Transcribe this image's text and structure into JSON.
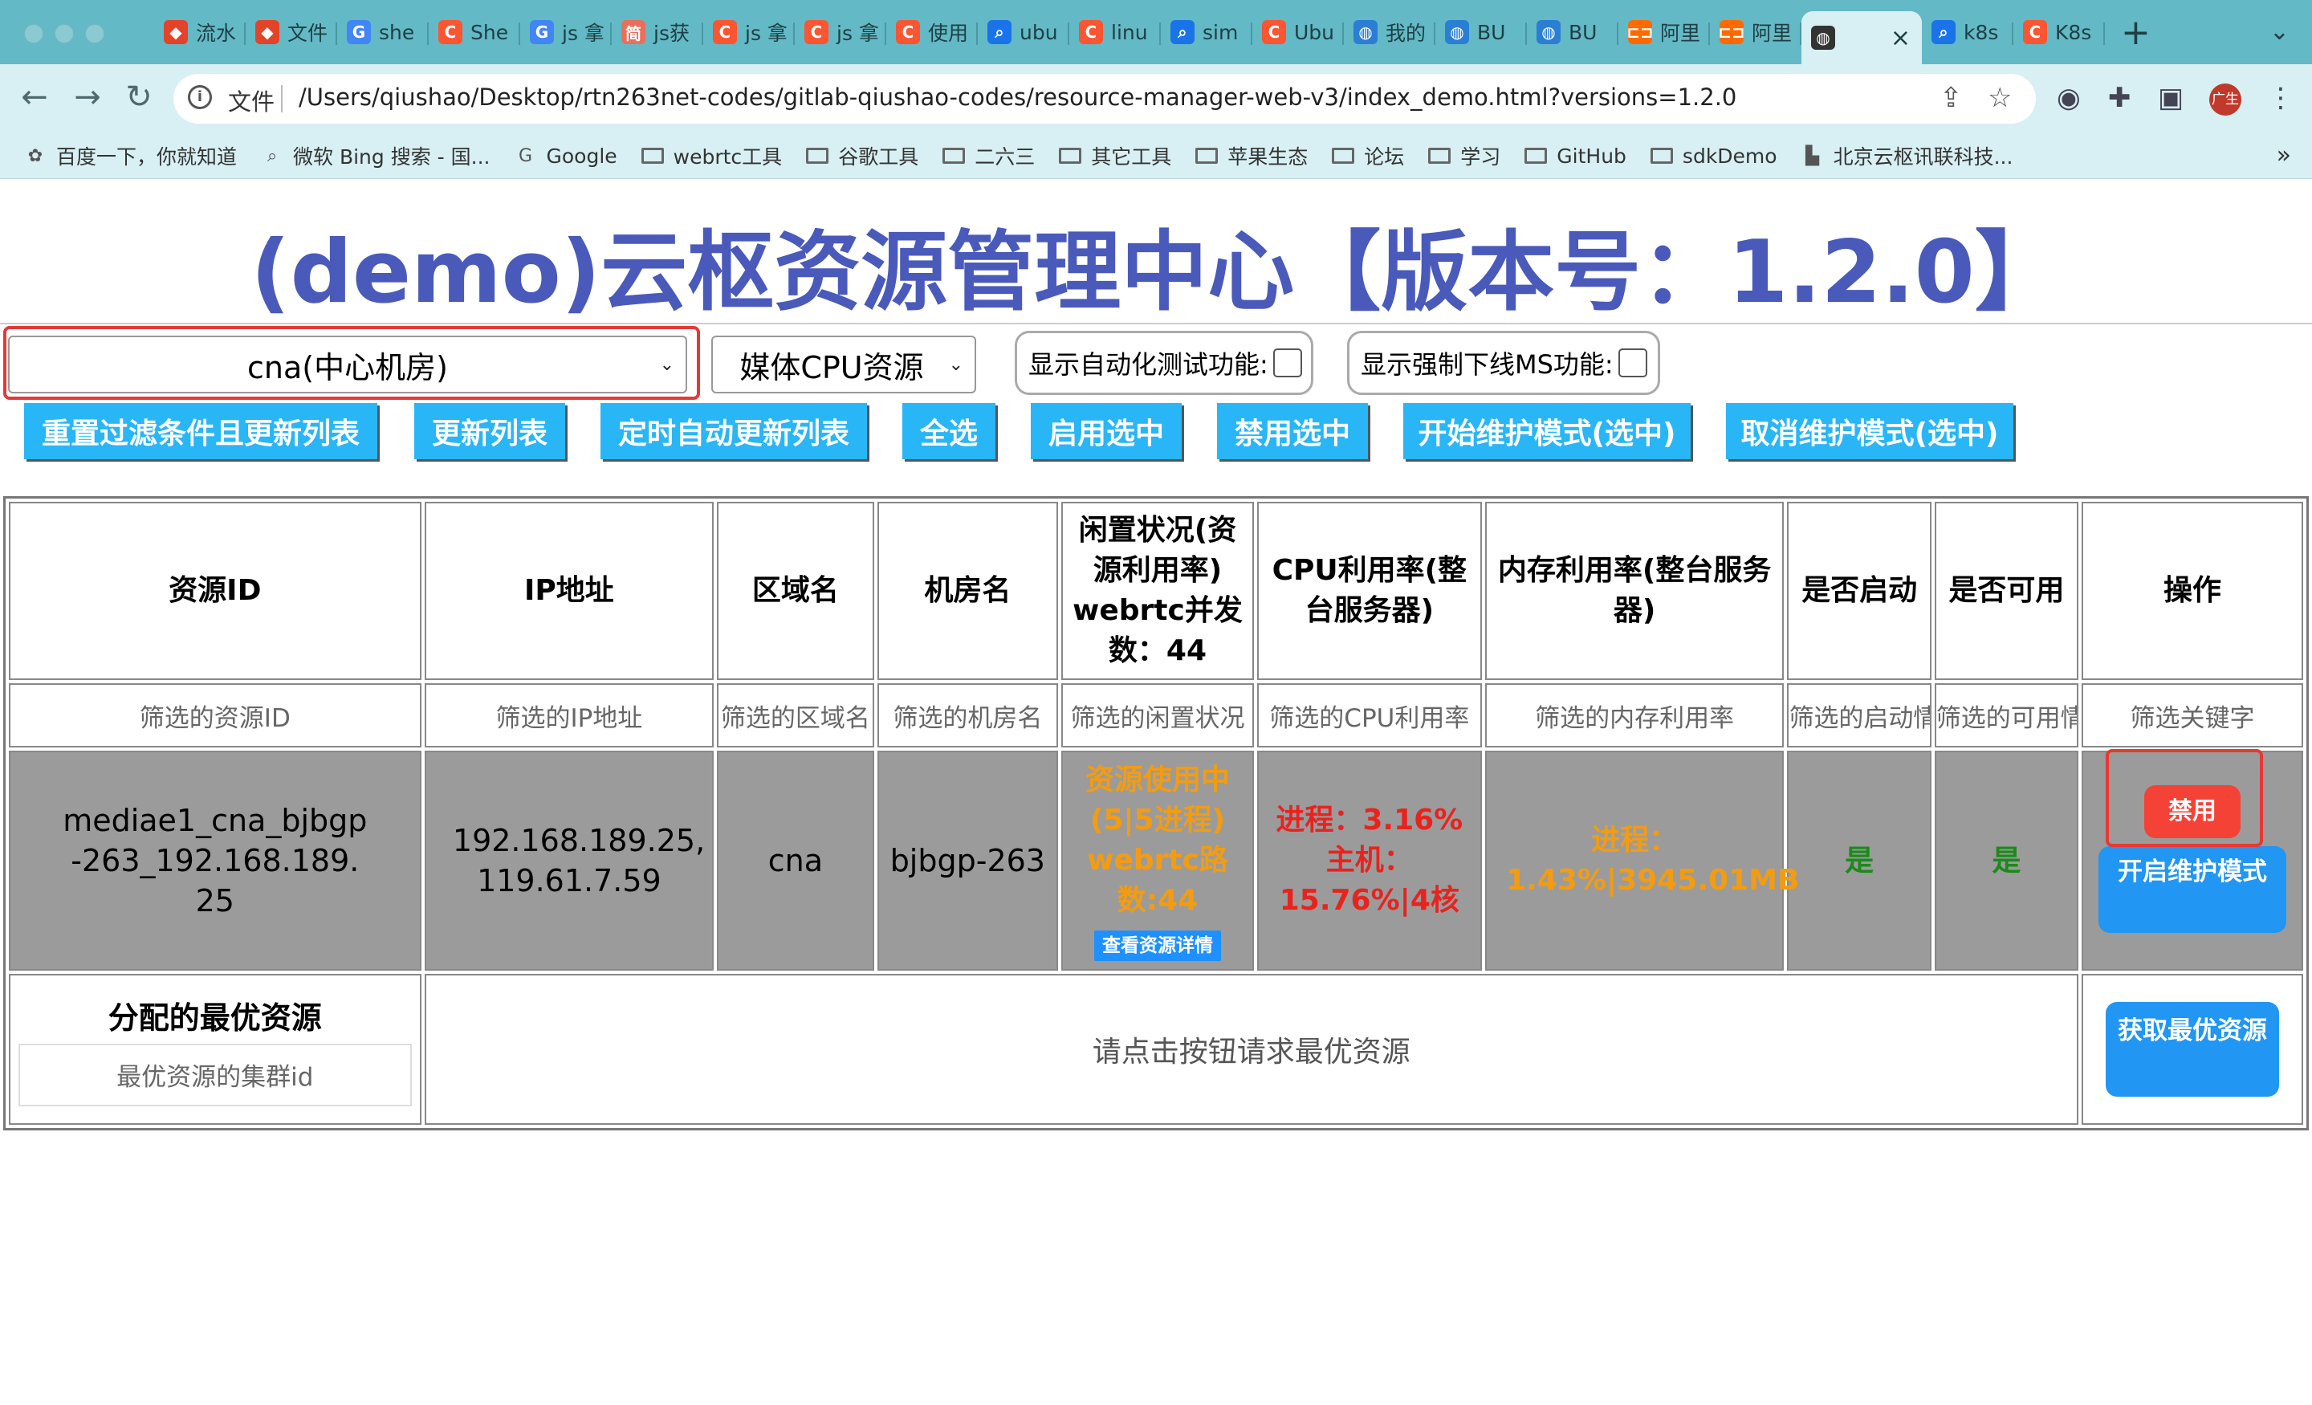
{
  "browser": {
    "tabs": [
      {
        "label": "流水",
        "icon": "gitlab-icon",
        "color": "#e24329"
      },
      {
        "label": "文件",
        "icon": "gitlab-icon",
        "color": "#e24329"
      },
      {
        "label": "she",
        "icon": "google-icon",
        "color": "#4285f4"
      },
      {
        "label": "She",
        "icon": "csdn-icon",
        "color": "#fc5531"
      },
      {
        "label": "js 拿",
        "icon": "google-icon",
        "color": "#4285f4"
      },
      {
        "label": "js获",
        "icon": "jianshu-icon",
        "color": "#ea6f5a"
      },
      {
        "label": "js 拿",
        "icon": "csdn-icon",
        "color": "#fc5531"
      },
      {
        "label": "js 拿",
        "icon": "csdn-icon",
        "color": "#fc5531"
      },
      {
        "label": "使用",
        "icon": "csdn-icon",
        "color": "#fc5531"
      },
      {
        "label": "ubu",
        "icon": "search-icon",
        "color": "#1a73e8"
      },
      {
        "label": "linu",
        "icon": "csdn-icon",
        "color": "#fc5531"
      },
      {
        "label": "sim",
        "icon": "search-icon",
        "color": "#1a73e8"
      },
      {
        "label": "Ubu",
        "icon": "csdn-icon",
        "color": "#fc5531"
      },
      {
        "label": "我的",
        "icon": "globe-icon",
        "color": "#2a7fd4"
      },
      {
        "label": "BU",
        "icon": "globe-icon",
        "color": "#2a7fd4"
      },
      {
        "label": "BU",
        "icon": "globe-icon",
        "color": "#2a7fd4"
      },
      {
        "label": "阿里",
        "icon": "aliyun-icon",
        "color": "#ff6a00"
      },
      {
        "label": "阿里",
        "icon": "aliyun-icon",
        "color": "#ff6a00"
      }
    ],
    "active_tab": {
      "label": "",
      "icon": "globe-icon"
    },
    "tabs_after": [
      {
        "label": "k8s",
        "icon": "search-icon",
        "color": "#1a73e8"
      },
      {
        "label": "K8s",
        "icon": "csdn-icon",
        "color": "#fc5531"
      }
    ],
    "new_tab_symbol": "+",
    "omnibox": {
      "scheme_label": "文件",
      "url": "/Users/qiushao/Desktop/rtn263net-codes/gitlab-qiushao-codes/resource-manager-web-v3/index_demo.html?versions=1.2.0"
    },
    "profile_label": "广生",
    "bookmarks": [
      {
        "label": "百度一下，你就知道",
        "icon": "baidu-icon"
      },
      {
        "label": "微软 Bing 搜索 - 国...",
        "icon": "search-icon"
      },
      {
        "label": "Google",
        "icon": "google-icon"
      },
      {
        "label": "webrtc工具",
        "icon": "folder-icon"
      },
      {
        "label": "谷歌工具",
        "icon": "folder-icon"
      },
      {
        "label": "二六三",
        "icon": "folder-icon"
      },
      {
        "label": "其它工具",
        "icon": "folder-icon"
      },
      {
        "label": "苹果生态",
        "icon": "folder-icon"
      },
      {
        "label": "论坛",
        "icon": "folder-icon"
      },
      {
        "label": "学习",
        "icon": "folder-icon"
      },
      {
        "label": "GitHub",
        "icon": "folder-icon"
      },
      {
        "label": "sdkDemo",
        "icon": "folder-icon"
      },
      {
        "label": "北京云枢讯联科技...",
        "icon": "bookmark-icon"
      }
    ],
    "bookmarks_more": "»"
  },
  "page": {
    "title": "(demo)云枢资源管理中心【版本号：1.2.0】",
    "region_select": "cna(中心机房)",
    "resource_type_select": "媒体CPU资源",
    "checkbox_auto_test": "显示自动化测试功能:",
    "checkbox_force_offline": "显示强制下线MS功能:",
    "buttons": {
      "reset": "重置过滤条件且更新列表",
      "refresh": "更新列表",
      "auto_refresh": "定时自动更新列表",
      "select_all": "全选",
      "enable_selected": "启用选中",
      "disable_selected": "禁用选中",
      "start_maintenance": "开始维护模式(选中)",
      "cancel_maintenance": "取消维护模式(选中)"
    },
    "table": {
      "headers": {
        "resource_id": "资源ID",
        "ip": "IP地址",
        "region": "区域名",
        "room": "机房名",
        "idle": "闲置状况(资源利用率) webrtc并发数：44",
        "cpu": "CPU利用率(整台服务器)",
        "mem": "内存利用率(整台服务器)",
        "started": "是否启动",
        "available": "是否可用",
        "action": "操作"
      },
      "filters": {
        "resource_id": "筛选的资源ID",
        "ip": "筛选的IP地址",
        "region": "筛选的区域名",
        "room": "筛选的机房名",
        "idle": "筛选的闲置状况",
        "cpu": "筛选的CPU利用率",
        "mem": "筛选的内存利用率",
        "started": "筛选的启动情况",
        "available": "筛选的可用情况",
        "keyword": "筛选关键字"
      },
      "row": {
        "resource_id": "mediae1_cna_bjbgp-263_192.168.189.25",
        "ip": "192.168.189.25, 119.61.7.59",
        "region": "cna",
        "room": "bjbgp-263",
        "idle_status": "资源使用中(5|5进程) webrtc路数:44",
        "detail_button": "查看资源详情",
        "cpu_process": "进程：3.16%",
        "cpu_host": "主机：15.76%|4核",
        "mem": "进程：1.43%|3945.01MB",
        "started": "是",
        "available": "是",
        "ban_button": "禁用",
        "maintenance_button": "开启维护模式"
      },
      "best": {
        "title": "分配的最优资源",
        "cluster_placeholder": "最优资源的集群id",
        "message": "请点击按钮请求最优资源",
        "get_button": "获取最优资源"
      }
    }
  }
}
